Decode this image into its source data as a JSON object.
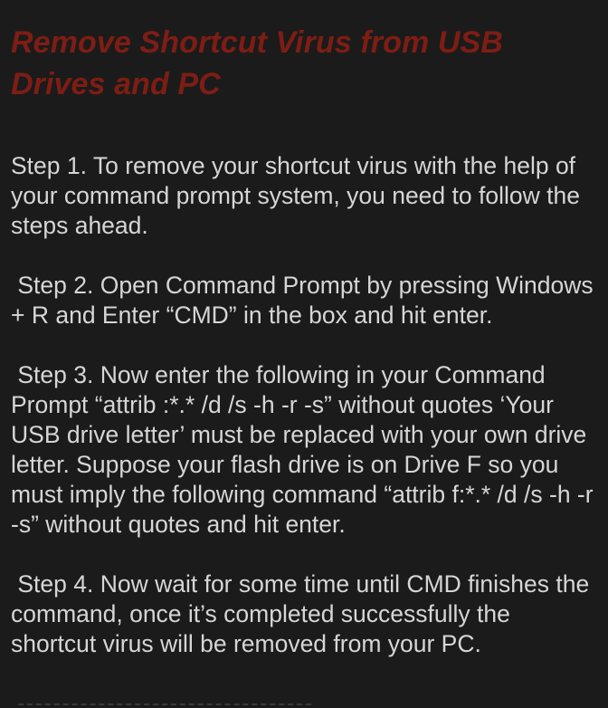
{
  "article": {
    "title": "Remove Shortcut Virus from USB Drives and PC",
    "steps": [
      "Step 1. To remove your shortcut virus with the help of your command prompt system, you need to follow the steps ahead.",
      " Step 2. Open Command Prompt by pressing Windows + R and Enter “CMD” in the box and hit enter.",
      " Step 3. Now enter the following in your Command Prompt “attrib :*.* /d /s -h -r -s” without quotes ‘Your USB drive letter’ must be replaced with your own drive letter. Suppose your flash drive is on Drive F so you must imply the following command “attrib f:*.* /d /s -h -r -s” without quotes and hit enter.",
      " Step 4. Now wait for some time until CMD finishes the command, once it’s completed successfully the shortcut virus will be removed from your PC."
    ]
  },
  "colors": {
    "background": "#1b1b1b",
    "title": "#7e1d14",
    "body_text": "#d6d6d6"
  }
}
